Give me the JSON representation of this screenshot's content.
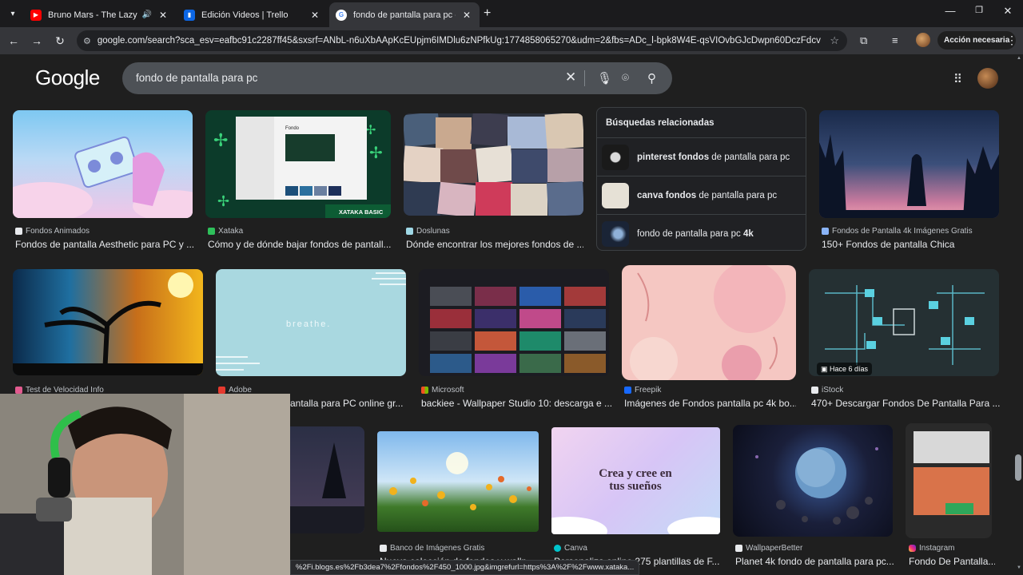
{
  "tabs": [
    {
      "title": "Bruno Mars - The Lazy Song",
      "favicon": "youtube-icon",
      "color": "#ff0000"
    },
    {
      "title": "Edición Videos | Trello",
      "favicon": "trello-icon",
      "color": "#0c66e4"
    },
    {
      "title": "fondo de pantalla para pc - Bus",
      "favicon": "google-icon",
      "color": "#4285f4"
    }
  ],
  "toolbar": {
    "url": "google.com/search?sca_esv=eafbc91c2287ff45&sxsrf=ANbL-n6uXbAApKcEUpjm6IMDlu6zNPfkUg:1774858065270&udm=2&fbs=ADc_l-bpk8W4E-qsVIOvbGJcDwpn60DczFdcvPnuv...",
    "accion_label": "Acción necesaria"
  },
  "header": {
    "logo": "Google",
    "query": "fondo de pantalla para pc"
  },
  "related": {
    "heading": "Búsquedas relacionadas",
    "items": [
      {
        "bold": "pinterest fondos",
        "rest": " de pantalla para pc"
      },
      {
        "bold": "canva fondos",
        "rest": " de pantalla para pc"
      },
      {
        "pre": "fondo de pantalla para pc ",
        "bold": "4k"
      }
    ]
  },
  "row1": [
    {
      "source": "Fondos Animados",
      "caption": "Fondos de pantalla Aesthetic para PC y ..."
    },
    {
      "source": "Xataka",
      "caption": "Cómo y de dónde bajar fondos de pantall..."
    },
    {
      "source": "Doslunas",
      "caption": "Dónde encontrar los mejores fondos de ..."
    },
    {
      "source": "Fondos de Pantalla 4k Imágenes Gratis",
      "caption": "150+ Fondos de pantalla Chica"
    }
  ],
  "row2": [
    {
      "source": "Test de Velocidad Info",
      "caption": ""
    },
    {
      "source": "Adobe",
      "caption": "antalla para PC online gr..."
    },
    {
      "source": "Microsoft",
      "caption": "backiee - Wallpaper Studio 10: descarga e ..."
    },
    {
      "source": "Freepik",
      "caption": "Imágenes de Fondos pantalla pc 4k bo..."
    },
    {
      "source": "iStock",
      "caption": "470+ Descargar Fondos De Pantalla Para ..."
    }
  ],
  "row3": [
    {
      "source": "Banco de Imágenes Gratis",
      "caption": "Nueva colección de fondos y wallp..."
    },
    {
      "source": "Canva",
      "caption": "Personaliza online 275 plantillas de F..."
    },
    {
      "source": "WallpaperBetter",
      "caption": "Planet 4k fondo de pantalla para pc..."
    },
    {
      "source": "Instagram",
      "caption": "Fondo De Pantalla..."
    }
  ],
  "thumb_texts": {
    "xataka_badge": "XATAKA BASIC",
    "xataka_window": "Fondo",
    "breathe": "breathe.",
    "canva_line1": "Crea y cree en",
    "canva_line2": "tus sueños",
    "istock_badge": "Hace 6 días"
  },
  "status_url": "%2Fi.blogs.es%2Fb3dea7%2Ffondos%2F450_1000.jpg&imgrefurl=https%3A%2F%2Fwww.xataka..."
}
